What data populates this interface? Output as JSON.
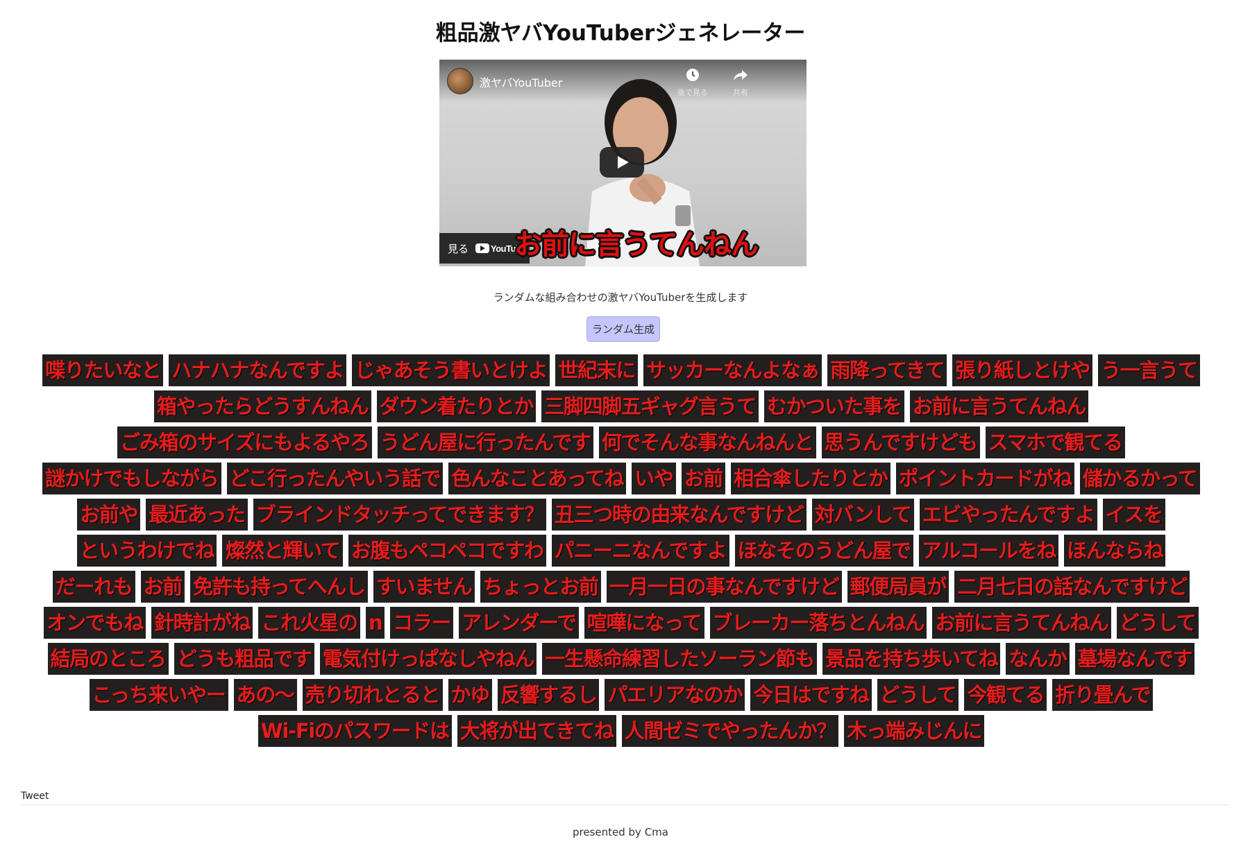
{
  "page_title": "粗品激ヤバYouTuberジェネレーター",
  "video": {
    "channel_title": "激ヤバYouTuber",
    "watch_later_label": "後で見る",
    "share_label": "共有",
    "watch_on_label": "見る",
    "youtube_label": "YouTube",
    "caption": "お前に言うてんねん"
  },
  "description": "ランダムな組み合わせの激ヤバYouTuberを生成します",
  "generate_button": "ランダム生成",
  "phrases": [
    "喋りたいなと",
    "ハナハナなんですよ",
    "じゃあそう書いとけよ",
    "世紀末に",
    "サッカーなんよなぁ",
    "雨降ってきて",
    "張り紙しとけや",
    "う一言うて",
    "箱やったらどうすんねん",
    "ダウン着たりとか",
    "三脚四脚五ギャグ言うて",
    "むかついた事を",
    "お前に言うてんねん",
    "ごみ箱のサイズにもよるやろ",
    "うどん屋に行ったんです",
    "何でそんな事なんねんと",
    "思うんですけども",
    "スマホで観てる",
    "謎かけでもしながら",
    "どこ行ったんやいう話で",
    "色んなことあってね",
    "いや",
    "お前",
    "相合傘したりとか",
    "ポイントカードがね",
    "儲かるかって",
    "お前や",
    "最近あった",
    "ブラインドタッチってできます？",
    "丑三つ時の由来なんですけど",
    "対バンして",
    "エビやったんですよ",
    "イスを",
    "というわけでね",
    "燦然と輝いて",
    "お腹もペコペコですわ",
    "パニーニなんですよ",
    "ほなそのうどん屋で",
    "アルコールをね",
    "ほんならね",
    "だーれも",
    "お前",
    "免許も持ってへんし",
    "すいません",
    "ちょっとお前",
    "一月一日の事なんですけど",
    "郵便局員が",
    "二月七日の話なんですけど",
    "オンでもね",
    "針時計がね",
    "これ火星の",
    "n",
    "コラー",
    "アレンダーで",
    "喧嘩になって",
    "ブレーカー落ちとんねん",
    "お前に言うてんねん",
    "どうして",
    "結局のところ",
    "どうも粗品です",
    "電気付けっぱなしやねん",
    "一生懸命練習したソーラン節も",
    "景品を持ち歩いてね",
    "なんか",
    "墓場なんです",
    "こっち来いやー",
    "あの～",
    "売り切れとると",
    "かゆ",
    "反響するし",
    "パエリアなのか",
    "今日はですね",
    "どうして",
    "今観てる",
    "折り畳んで",
    "Wi-Fiのパスワードは",
    "大将が出てきてね",
    "人間ゼミでやったんか？",
    "木っ端みじんに"
  ],
  "tweet_label": "Tweet",
  "footer": "presented by Cma",
  "colors": {
    "chip_bg": "#231f1f",
    "chip_text": "#e51c1c",
    "button_bg": "#c5c6fb"
  }
}
